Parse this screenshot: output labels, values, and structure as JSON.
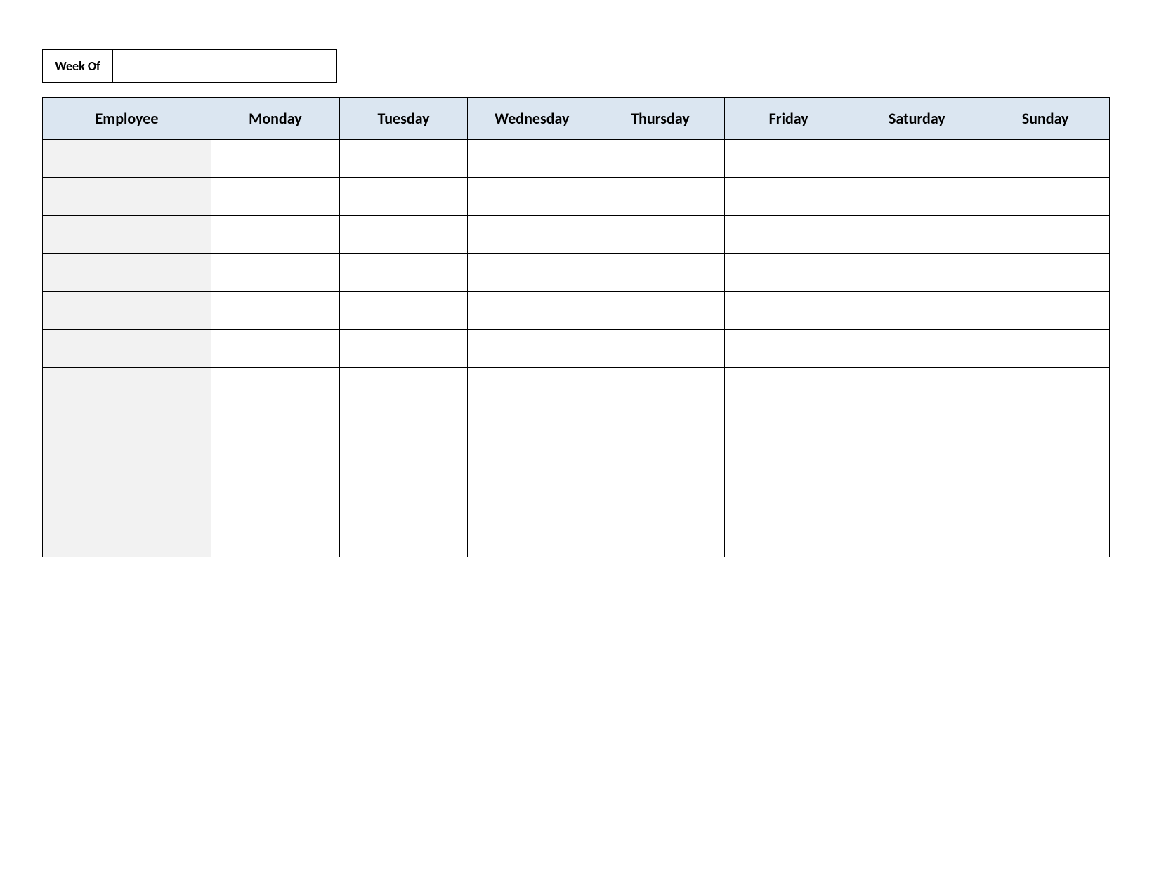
{
  "weekOf": {
    "label": "Week Of",
    "value": ""
  },
  "headers": {
    "employee": "Employee",
    "days": [
      "Monday",
      "Tuesday",
      "Wednesday",
      "Thursday",
      "Friday",
      "Saturday",
      "Sunday"
    ]
  },
  "rows": [
    {
      "employee": "",
      "cells": [
        "",
        "",
        "",
        "",
        "",
        "",
        ""
      ]
    },
    {
      "employee": "",
      "cells": [
        "",
        "",
        "",
        "",
        "",
        "",
        ""
      ]
    },
    {
      "employee": "",
      "cells": [
        "",
        "",
        "",
        "",
        "",
        "",
        ""
      ]
    },
    {
      "employee": "",
      "cells": [
        "",
        "",
        "",
        "",
        "",
        "",
        ""
      ]
    },
    {
      "employee": "",
      "cells": [
        "",
        "",
        "",
        "",
        "",
        "",
        ""
      ]
    },
    {
      "employee": "",
      "cells": [
        "",
        "",
        "",
        "",
        "",
        "",
        ""
      ]
    },
    {
      "employee": "",
      "cells": [
        "",
        "",
        "",
        "",
        "",
        "",
        ""
      ]
    },
    {
      "employee": "",
      "cells": [
        "",
        "",
        "",
        "",
        "",
        "",
        ""
      ]
    },
    {
      "employee": "",
      "cells": [
        "",
        "",
        "",
        "",
        "",
        "",
        ""
      ]
    },
    {
      "employee": "",
      "cells": [
        "",
        "",
        "",
        "",
        "",
        "",
        ""
      ]
    },
    {
      "employee": "",
      "cells": [
        "",
        "",
        "",
        "",
        "",
        "",
        ""
      ]
    }
  ],
  "colors": {
    "headerFill": "#dbe6f1",
    "employeeColFill": "#f2f2f2",
    "border": "#000000"
  }
}
